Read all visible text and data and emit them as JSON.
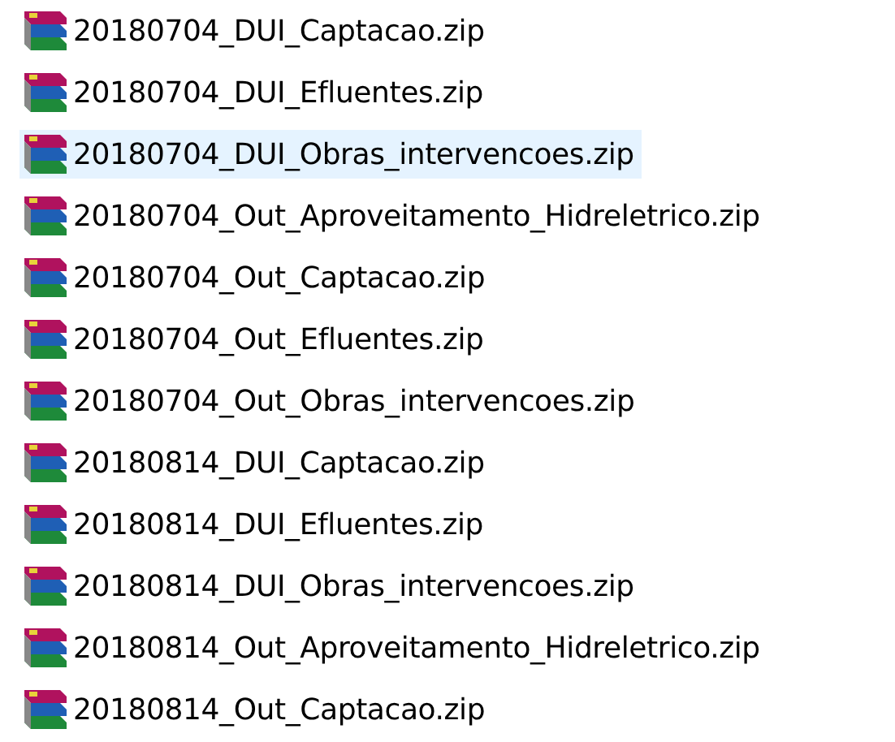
{
  "files": [
    {
      "name": "20180704_DUI_Captacao.zip",
      "selected": false
    },
    {
      "name": "20180704_DUI_Efluentes.zip",
      "selected": false
    },
    {
      "name": "20180704_DUI_Obras_intervencoes.zip",
      "selected": true
    },
    {
      "name": "20180704_Out_Aproveitamento_Hidreletrico.zip",
      "selected": false
    },
    {
      "name": "20180704_Out_Captacao.zip",
      "selected": false
    },
    {
      "name": "20180704_Out_Efluentes.zip",
      "selected": false
    },
    {
      "name": "20180704_Out_Obras_intervencoes.zip",
      "selected": false
    },
    {
      "name": "20180814_DUI_Captacao.zip",
      "selected": false
    },
    {
      "name": "20180814_DUI_Efluentes.zip",
      "selected": false
    },
    {
      "name": "20180814_DUI_Obras_intervencoes.zip",
      "selected": false
    },
    {
      "name": "20180814_Out_Aproveitamento_Hidreletrico.zip",
      "selected": false
    },
    {
      "name": "20180814_Out_Captacao.zip",
      "selected": false
    }
  ]
}
